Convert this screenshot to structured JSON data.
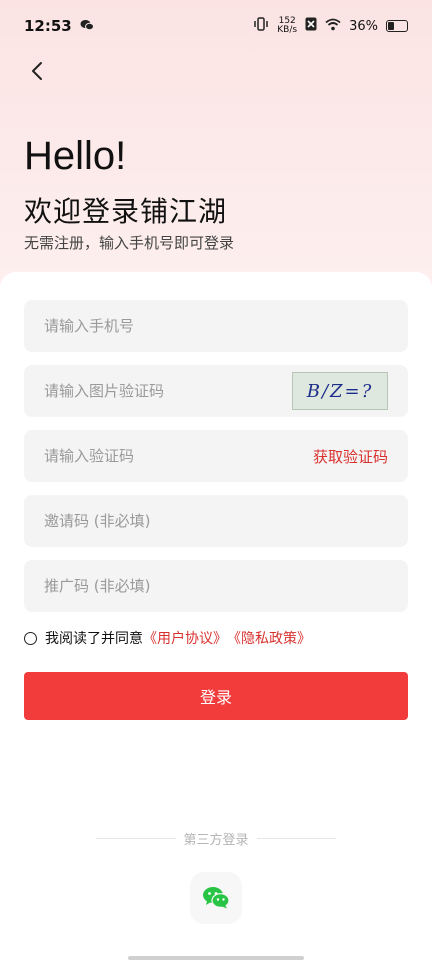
{
  "status_bar": {
    "time": "12:53",
    "net_speed_value": "152",
    "net_speed_unit": "KB/s",
    "battery": "36%",
    "battery_level": 0.36
  },
  "header": {
    "hello": "Hello!",
    "welcome": "欢迎登录铺江湖",
    "subtitle": "无需注册，输入手机号即可登录"
  },
  "form": {
    "phone_placeholder": "请输入手机号",
    "image_code_placeholder": "请输入图片验证码",
    "captcha_text": "B/Z=?",
    "sms_code_placeholder": "请输入验证码",
    "get_code_label": "获取验证码",
    "invite_placeholder": "邀请码 (非必填)",
    "promo_placeholder": "推广码 (非必填)"
  },
  "agreement": {
    "prefix": "我阅读了并同意",
    "user_agreement": "《用户协议》",
    "privacy_policy": "《隐私政策》"
  },
  "login_button": "登录",
  "third_party": {
    "label": "第三方登录"
  },
  "colors": {
    "accent": "#f23c3c",
    "link": "#d8322f",
    "wechat": "#28c445"
  }
}
